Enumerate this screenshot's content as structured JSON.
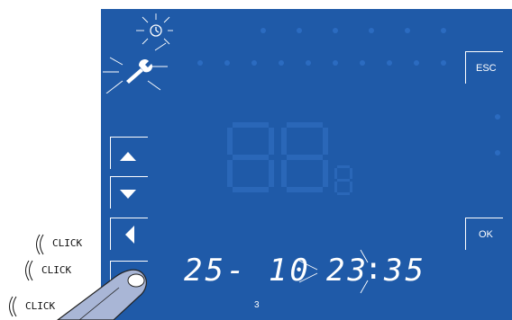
{
  "screen": {
    "background": "#1f5aa8",
    "date_text": "25- 10",
    "time_hours": "23",
    "time_colon": ":",
    "time_minutes": "35",
    "day_indicator": "3",
    "icons": {
      "clock": "clock-icon",
      "wrench": "wrench-icon",
      "blinking": true
    }
  },
  "buttons": {
    "esc_label": "ESC",
    "ok_label": "OK",
    "left_column": [
      "up-arrow",
      "down-arrow",
      "left-arrow",
      "right-arrow"
    ]
  },
  "annotations": {
    "click_labels": [
      "CLICK",
      "CLICK",
      "CLICK"
    ]
  }
}
